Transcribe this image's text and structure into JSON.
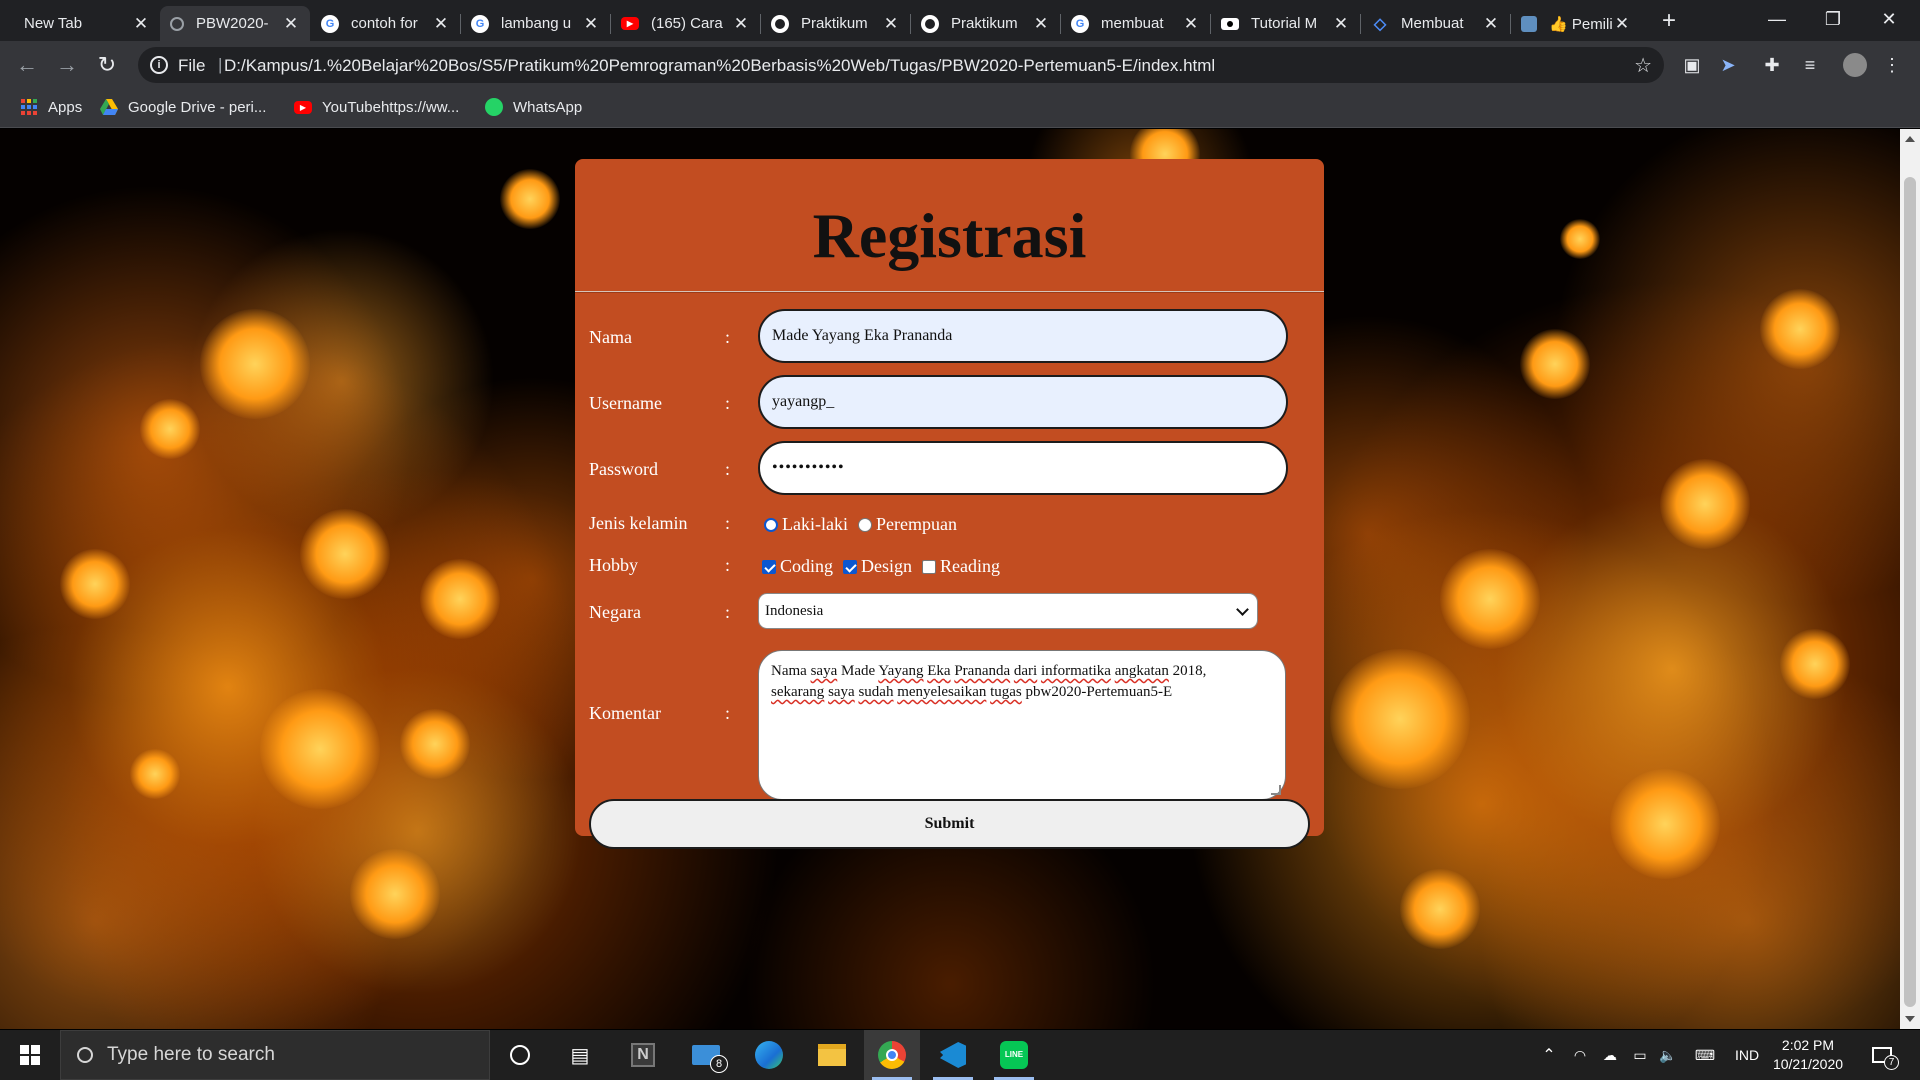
{
  "browser": {
    "tabs": [
      {
        "title": "New Tab",
        "icon": "no-favicon",
        "active": false
      },
      {
        "title": "PBW2020-",
        "icon": "page-icon",
        "active": true
      },
      {
        "title": "contoh for",
        "icon": "google-icon",
        "active": false
      },
      {
        "title": "lambang u",
        "icon": "google-icon",
        "active": false
      },
      {
        "title": "(165) Cara",
        "icon": "youtube-icon",
        "active": false
      },
      {
        "title": "Praktikum",
        "icon": "github-icon",
        "active": false
      },
      {
        "title": "Praktikum",
        "icon": "github-icon",
        "active": false
      },
      {
        "title": "membuat",
        "icon": "google-icon",
        "active": false
      },
      {
        "title": "Tutorial M",
        "icon": "medium-icon",
        "active": false
      },
      {
        "title": "Membuat",
        "icon": "code-icon",
        "active": false
      },
      {
        "title": "👍 Pemilih",
        "icon": "pen-icon",
        "active": false
      }
    ],
    "address": {
      "scheme_label": "File",
      "url": "D:/Kampus/1.%20Belajar%20Bos/S5/Pratikum%20Pemrograman%20Berbasis%20Web/Tugas/PBW2020-Pertemuan5-E/index.html"
    },
    "bookmarks": [
      {
        "label": "Apps",
        "icon": "apps-grid-icon"
      },
      {
        "label": "Google Drive - peri...",
        "icon": "google-drive-icon"
      },
      {
        "label": "YouTubehttps://ww...",
        "icon": "youtube-icon"
      },
      {
        "label": "WhatsApp",
        "icon": "whatsapp-icon"
      }
    ]
  },
  "form": {
    "title": "Registrasi",
    "separator": ":",
    "nama": {
      "label": "Nama",
      "value": "Made Yayang Eka Prananda"
    },
    "username": {
      "label": "Username",
      "value": "yayangp_"
    },
    "password": {
      "label": "Password",
      "value": "•••••••••••"
    },
    "gender": {
      "label": "Jenis kelamin",
      "options": [
        {
          "label": "Laki-laki",
          "checked": true
        },
        {
          "label": "Perempuan",
          "checked": false
        }
      ]
    },
    "hobby": {
      "label": "Hobby",
      "options": [
        {
          "label": "Coding",
          "checked": true
        },
        {
          "label": "Design",
          "checked": true
        },
        {
          "label": "Reading",
          "checked": false
        }
      ]
    },
    "negara": {
      "label": "Negara",
      "selected": "Indonesia"
    },
    "komentar": {
      "label": "Komentar",
      "line1": {
        "w1": "Nama",
        "w2": "saya",
        "w3": "Made",
        "w4": "Yayang",
        "w5": "Eka",
        "w6": "Prananda",
        "w7": "dari",
        "w8": "informatika",
        "w9": "angkatan",
        "w10": "2018,"
      },
      "line2": {
        "w1": "sekarang",
        "w2": "saya",
        "w3": "sudah",
        "w4": "menyelesaikan",
        "w5": "tugas",
        "w6": "pbw2020-Pertemuan5-E"
      }
    },
    "submit_label": "Submit"
  },
  "taskbar": {
    "search_placeholder": "Type here to search",
    "mail_badge": "8",
    "language": "IND",
    "time": "2:02 PM",
    "date": "10/21/2020",
    "notification_count": "7"
  },
  "colors": {
    "card_bg": "#c24d21",
    "autofill_bg": "#e8f0fe",
    "checkbox_accent": "#0b57d0"
  }
}
